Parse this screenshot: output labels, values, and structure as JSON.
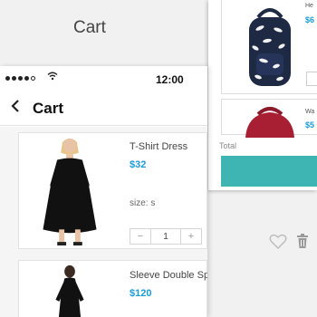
{
  "background": {
    "title": "Cart"
  },
  "back_screen": {
    "items": [
      {
        "name": "He",
        "price": "$6"
      },
      {
        "name": "Wa",
        "price": "$5"
      }
    ],
    "total_label": "Total"
  },
  "status_bar": {
    "time": "12:00"
  },
  "nav": {
    "title": "Cart"
  },
  "items": [
    {
      "name": "T-Shirt Dress",
      "price": "$32",
      "size": "size: s",
      "quantity": "1"
    },
    {
      "name": "Sleeve Double Split Maxi Dress",
      "price": "$120"
    }
  ],
  "stepper": {
    "minus": "−",
    "plus": "+"
  },
  "icons": {
    "back": "chevron-left-icon",
    "favorite": "heart-icon",
    "delete": "trash-icon",
    "wifi": "wifi-icon"
  },
  "colors": {
    "accent": "#1a9bd7",
    "checkout": "#3fb5b3"
  }
}
